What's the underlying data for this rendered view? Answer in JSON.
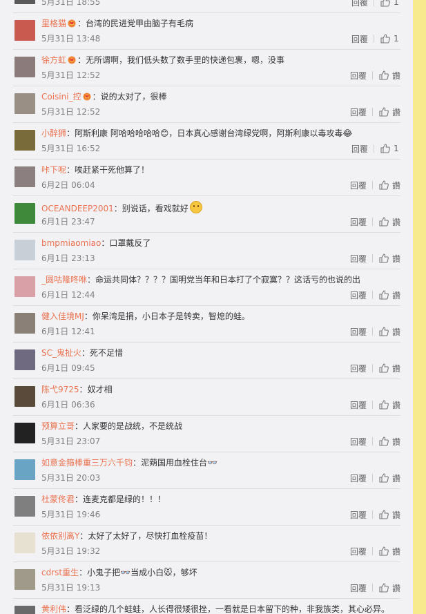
{
  "comments": [
    {
      "user": "",
      "badge": false,
      "text": "",
      "time": "5月31日 18:55",
      "reply": "回覆",
      "likes": "1",
      "avatar": "#5a5a5a"
    },
    {
      "user": "里格猫",
      "badge": true,
      "text": "台湾的民进党甲由脑子有毛病",
      "time": "5月31日 13:48",
      "reply": "回覆",
      "likes": "1",
      "avatar": "#c95a4f"
    },
    {
      "user": "徐方虹",
      "badge": true,
      "text": "无所谓啊，我们低头数了数手里的快递包裹，嗯，没事",
      "time": "5月31日 12:52",
      "reply": "回覆",
      "likes": "讚",
      "avatar": "#8b7b7a"
    },
    {
      "user": "Coisini_控",
      "badge": true,
      "text": "说的太对了，很棒",
      "time": "5月31日 12:52",
      "reply": "回覆",
      "likes": "讚",
      "avatar": "#9a8f85"
    },
    {
      "user": "小醉狮",
      "badge": false,
      "text": "阿斯利康 阿哈哈哈哈哈😊，日本真心感谢台湾绿党啊，阿斯利康以毒攻毒😂",
      "time": "5月31日 16:52",
      "reply": "回覆",
      "likes": "1",
      "avatar": "#7a6b3a"
    },
    {
      "user": "咔下呢",
      "badge": false,
      "text": "唉赶紧干死他算了！",
      "time": "6月2日 06:04",
      "reply": "回覆",
      "likes": "讚",
      "avatar": "#8c7f80"
    },
    {
      "user": "OCEANDEEP2001",
      "badge": false,
      "text": "别说话，看戏就好",
      "time": "6月1日 23:47",
      "reply": "回覆",
      "likes": "讚",
      "avatar": "#3f8a3a",
      "emoji": true
    },
    {
      "user": "bmpmiaomiao",
      "badge": false,
      "text": "口罩戴反了",
      "time": "6月1日 23:13",
      "reply": "回覆",
      "likes": "讚",
      "avatar": "#c9cfd6"
    },
    {
      "user": "_圆咕隆咚咻",
      "badge": false,
      "text": "命运共同体？？？？国明党当年和日本打了个寂寞？？这话亏的也说的出",
      "time": "6月1日 12:44",
      "reply": "回覆",
      "likes": "讚",
      "avatar": "#d9a0a8"
    },
    {
      "user": "健入佳境MJ",
      "badge": false,
      "text": "你呆湾是捐，小日本子是转卖，智熄的蛙。",
      "time": "6月1日 12:41",
      "reply": "回覆",
      "likes": "讚",
      "avatar": "#8a8078"
    },
    {
      "user": "SC_鬼扯火",
      "badge": false,
      "text": "死不足惜",
      "time": "6月1日 09:45",
      "reply": "回覆",
      "likes": "讚",
      "avatar": "#6f6a80"
    },
    {
      "user": "陈弋9725",
      "badge": false,
      "text": "奴才相",
      "time": "6月1日 06:36",
      "reply": "回覆",
      "likes": "讚",
      "avatar": "#5a4a3a"
    },
    {
      "user": "预算立哥",
      "badge": false,
      "text": "人家要的是战统，不是统战",
      "time": "5月31日 23:07",
      "reply": "回覆",
      "likes": "讚",
      "avatar": "#222222"
    },
    {
      "user": "如意金箍棒重三万六千钧",
      "badge": false,
      "text": "泥蒴国用血栓住台👓",
      "time": "5月31日 20:03",
      "reply": "回覆",
      "likes": "讚",
      "avatar": "#6aa4c4"
    },
    {
      "user": "杜蒙佟君",
      "badge": false,
      "text": "连麦克都是绿的！！！",
      "time": "5月31日 19:46",
      "reply": "回覆",
      "likes": "讚",
      "avatar": "#7f7f7f"
    },
    {
      "user": "依依别离Y",
      "badge": false,
      "text": "太好了太好了，尽快打血栓疫苗！",
      "time": "5月31日 19:32",
      "reply": "回覆",
      "likes": "讚",
      "avatar": "#e6e1d0"
    },
    {
      "user": "cdrst重生",
      "badge": false,
      "text": "小鬼子把👓当成小白🐭，够坏",
      "time": "5月31日 19:13",
      "reply": "回覆",
      "likes": "讚",
      "avatar": "#a09a8a"
    },
    {
      "user": "黄利伟",
      "badge": false,
      "text": "看泛绿的几个蛙蛙，人长得很矮很挫，一看就是日本留下的种，非我族类，其心必异。",
      "time": "",
      "reply": "",
      "likes": "",
      "avatar": "#6a6a6a"
    }
  ]
}
